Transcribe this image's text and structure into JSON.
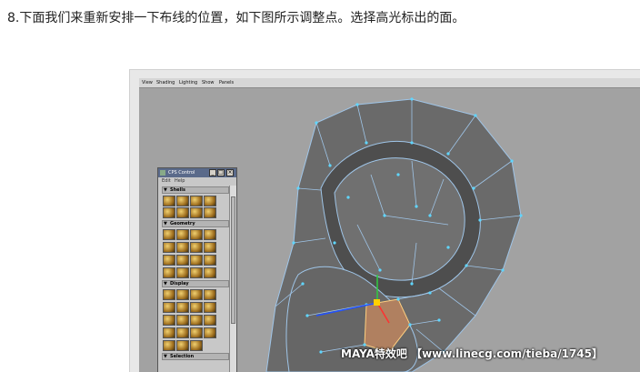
{
  "article": {
    "step_text": "8.下面我们来重新安排一下布线的位置，如下图所示调整点。选择高光标出的面。"
  },
  "viewport": {
    "menu": [
      "View",
      "Shading",
      "Lighting",
      "Show",
      "Panels"
    ],
    "watermark": "MAYA特效吧 【www.linecg.com/tieba/1745】"
  },
  "cps_panel": {
    "title": "CPS Control",
    "menu": [
      "Edit",
      "Help"
    ],
    "sections": [
      "Shells",
      "Geometry",
      "Display",
      "Selection"
    ],
    "window_buttons": [
      "_",
      "□",
      "×"
    ]
  },
  "colors": {
    "viewport_bg": "#a2a2a2",
    "mesh_face": "#6e6e6e",
    "mesh_edge": "#9fc5e8",
    "vertex": "#5fd6ff",
    "highlight_face": "#b08060"
  }
}
